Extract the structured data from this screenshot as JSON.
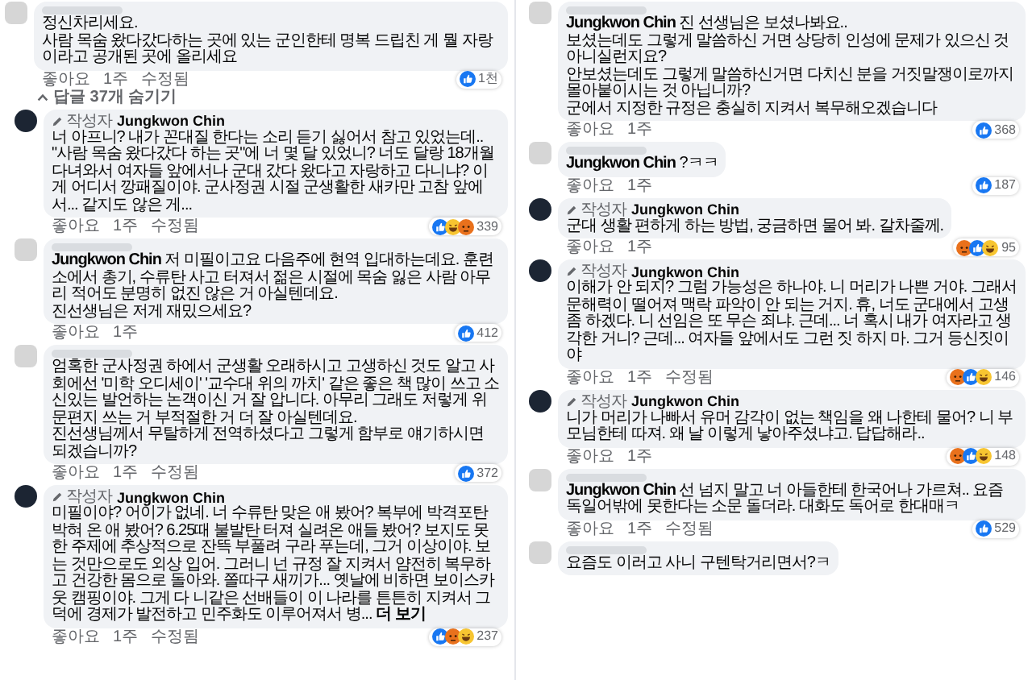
{
  "left_panel": {
    "comments": [
      {
        "avatar": {
          "kind": "blurred"
        },
        "name_hidden": true,
        "paragraphs": [
          "정신차리세요.",
          "사람 목숨 왔다갔다하는 곳에 있는 군인한테 명복 드립친 게 뭘 자랑이라고 공개된 곳에 올리세요"
        ],
        "reactions": [
          {
            "kind": "like"
          }
        ],
        "reaction_count": "1천",
        "actions": [
          "좋아요",
          "1주",
          "수정됨"
        ],
        "replies_toggle": "답글 37개 숨기기",
        "replies": [
          {
            "avatar": {
              "kind": "dark"
            },
            "author_tag": "작성자",
            "author": "Jungkwon Chin",
            "paragraphs": [
              "너 아프니? 내가 꼰대질 한다는 소리 듣기 싫어서 참고 있었는데.. \"사람 목숨 왔다갔다 하는 곳\"에 너 몇 달 있었니? 너도 달랑 18개월 다녀와서 여자들 앞에서나 군대 갔다 왔다고 자랑하고 다니냐? 이게 어디서 깡패질이야. 군사정권 시절 군생활한 새카만 고참 앞에서... 같지도 않은 게..."
            ],
            "reactions": [
              {
                "kind": "like"
              },
              {
                "kind": "haha"
              },
              {
                "kind": "angry"
              }
            ],
            "reaction_count": "339",
            "actions": [
              "좋아요",
              "1주",
              "수정됨"
            ]
          },
          {
            "avatar": {
              "kind": "blurred"
            },
            "name_hidden": true,
            "paragraphs": [
              "**Jungkwon Chin** 저 미필이고요 다음주에 현역 입대하는데요. 훈련소에서 총기, 수류탄 사고 터져서 젊은 시절에 목숨 잃은 사람 아무리 적어도 분명히 없진 않은 거 아실텐데요.",
              "진선생님은 저게 재밌으세요?"
            ],
            "reactions": [
              {
                "kind": "like"
              }
            ],
            "reaction_count": "412",
            "actions": [
              "좋아요",
              "1주"
            ]
          },
          {
            "avatar": {
              "kind": "blurred"
            },
            "name_hidden": true,
            "paragraphs": [
              "엄혹한 군사정권 하에서 군생활 오래하시고 고생하신 것도 알고 사회에선 '미학 오디세이' '교수대 위의 까치' 같은 좋은 책 많이 쓰고 소신있는 발언하는 논객이신 거 잘 압니다. 아무리 그래도 저렇게 위문편지 쓰는 거 부적절한 거 더 잘 아실텐데요.",
              "진선생님께서 무탈하게 전역하셨다고 그렇게 함부로 얘기하시면 되겠습니까?"
            ],
            "reactions": [
              {
                "kind": "like"
              }
            ],
            "reaction_count": "372",
            "actions": [
              "좋아요",
              "1주",
              "수정됨"
            ]
          },
          {
            "avatar": {
              "kind": "dark"
            },
            "author_tag": "작성자",
            "author": "Jungkwon Chin",
            "paragraphs": [
              "미필이야? 어이가 없네. 너 수류탄 맞은 애 봤어? 복부에 박격포탄 박혀 온 애 봤어? 6.25때 불발탄 터져 실려온 애들 봤어? 보지도 못한 주제에 추상적으로 잔뜩 부풀려 구라 푸는데, 그거 이상이야. 보는 것만으로도 외상 입어. 그러니 넌 규정 잘 지켜서 얌전히 복무하고 건강한 몸으로 돌아와. 쫄따구 새끼가... 옛날에 비하면 보이스카웃 캠핑이야. 그게 다 니같은 선배들이 이 나라를 튼튼히 지켜서 그 덕에 경제가 발전하고 민주화도 이루어져서 병..."
            ],
            "see_more": "더 보기",
            "reactions": [
              {
                "kind": "like"
              },
              {
                "kind": "angry"
              },
              {
                "kind": "haha"
              }
            ],
            "reaction_count": "237",
            "actions": [
              "좋아요",
              "1주",
              "수정됨"
            ]
          }
        ]
      }
    ]
  },
  "right_panel": {
    "replies": [
      {
        "avatar": {
          "kind": "blurred"
        },
        "name_hidden": true,
        "paragraphs": [
          "**Jungkwon Chin** 진 선생님은 보셨나봐요..",
          "보셨는데도 그렇게 말씀하신 거면 상당히 인성에 문제가 있으신 것 아니실런지요?",
          "안보셨는데도 그렇게 말씀하신거면 다치신 분을 거짓말쟁이로까지 몰아붙이시는 것 아닙니까?",
          "군에서 지정한 규정은 충실히 지켜서 복무해오겠습니다"
        ],
        "reactions": [
          {
            "kind": "like"
          }
        ],
        "reaction_count": "368",
        "actions": [
          "좋아요",
          "1주"
        ]
      },
      {
        "avatar": {
          "kind": "blurred"
        },
        "name_hidden": true,
        "paragraphs": [
          "**Jungkwon Chin** ?ㅋㅋ"
        ],
        "reactions": [
          {
            "kind": "like"
          }
        ],
        "reaction_count": "187",
        "actions": [
          "좋아요",
          "1주"
        ]
      },
      {
        "avatar": {
          "kind": "dark"
        },
        "author_tag": "작성자",
        "author": "Jungkwon Chin",
        "paragraphs": [
          "군대 생활 편하게 하는 방법, 궁금하면 물어 봐. 갈차줄께."
        ],
        "reactions": [
          {
            "kind": "angry"
          },
          {
            "kind": "like"
          },
          {
            "kind": "haha"
          }
        ],
        "reaction_count": "95",
        "actions": [
          "좋아요",
          "1주"
        ]
      },
      {
        "avatar": {
          "kind": "dark"
        },
        "author_tag": "작성자",
        "author": "Jungkwon Chin",
        "paragraphs": [
          "이해가 안 되지? 그럼 가능성은 하나야. 니 머리가 나쁜 거야. 그래서 문해력이 떨어져 맥락 파악이 안 되는 거지. 휴, 너도 군대에서 고생 좀 하겠다. 니 선임은 또 무슨 죄냐. 근데... 너 혹시 내가 여자라고 생각한 거니? 근데... 여자들 앞에서도 그런 짓 하지 마. 그거 등신짓이야"
        ],
        "reactions": [
          {
            "kind": "angry"
          },
          {
            "kind": "like"
          },
          {
            "kind": "haha"
          }
        ],
        "reaction_count": "146",
        "actions": [
          "좋아요",
          "1주",
          "수정됨"
        ]
      },
      {
        "avatar": {
          "kind": "dark"
        },
        "author_tag": "작성자",
        "author": "Jungkwon Chin",
        "paragraphs": [
          "니가 머리가 나빠서 유머 감각이 없는 책임을 왜 나한테 물어? 니 부모님한테 따져. 왜 날 이렇게 낳아주셨냐고. 답답해라.."
        ],
        "reactions": [
          {
            "kind": "angry"
          },
          {
            "kind": "like"
          },
          {
            "kind": "haha"
          }
        ],
        "reaction_count": "148",
        "actions": [
          "좋아요",
          "1주"
        ]
      },
      {
        "avatar": {
          "kind": "blurred"
        },
        "name_hidden": true,
        "paragraphs": [
          "**Jungkwon Chin** 선 넘지 말고 너 아들한테 한국어나 가르쳐.. 요즘 독일어밖에 못한다는 소문 돌더라. 대화도 독어로 한대매ㅋ"
        ],
        "reactions": [
          {
            "kind": "like"
          }
        ],
        "reaction_count": "529",
        "actions": [
          "좋아요",
          "1주",
          "수정됨"
        ]
      },
      {
        "avatar": {
          "kind": "blurred"
        },
        "name_hidden": true,
        "paragraphs": [
          "요즘도 이러고 사니 구텐탁거리면서?ㅋ"
        ]
      }
    ]
  }
}
